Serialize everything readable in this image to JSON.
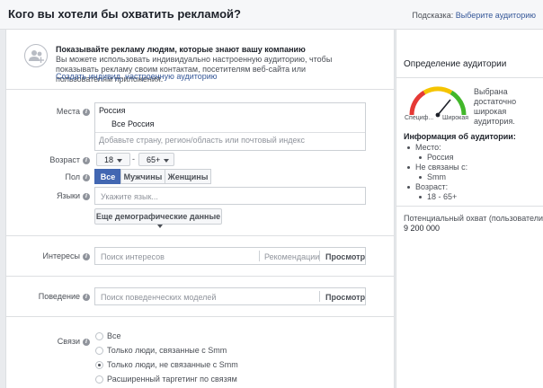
{
  "header": {
    "title": "Кого вы хотели бы охватить рекламой?",
    "hint_prefix": "Подсказка: ",
    "hint_link": "Выберите аудиторию"
  },
  "custom_audience": {
    "title": "Показывайте рекламу людям, которые знают вашу компанию",
    "description": "Вы можете использовать индивидуально настроенную аудиторию, чтобы показывать рекламу своим контактам, посетителям веб-сайта или пользователям приложения.",
    "link": "Создать индивид. настроенную аудиторию"
  },
  "locations": {
    "label": "Места",
    "country": "Россия",
    "region": "Все Россия",
    "placeholder": "Добавьте страну, регион/область или почтовый индекс"
  },
  "age": {
    "label": "Возраст",
    "min": "18",
    "dash": "-",
    "max": "65+"
  },
  "gender": {
    "label": "Пол",
    "options": [
      "Все",
      "Мужчины",
      "Женщины"
    ],
    "selected": 0
  },
  "languages": {
    "label": "Языки",
    "placeholder": "Укажите язык..."
  },
  "more_demographics": "Еще демографические данные",
  "interests": {
    "label": "Интересы",
    "placeholder": "Поиск интересов",
    "suggestions": "Рекомендации",
    "browse": "Просмотр"
  },
  "behaviors": {
    "label": "Поведение",
    "placeholder": "Поиск поведенческих моделей",
    "browse": "Просмотр"
  },
  "connections": {
    "label": "Связи",
    "options": [
      "Все",
      "Только люди, связанные с Smm",
      "Только люди, не связанные с Smm",
      "Расширенный таргетинг по связям"
    ],
    "selected": 2
  },
  "sidebar": {
    "title": "Определение аудитории",
    "gauge": {
      "left_label": "Специф...",
      "right_label": "Широкая",
      "description": "Выбрана достаточно широкая аудитория.",
      "level": 0.72
    },
    "audience_title": "Информация об аудитории:",
    "audience": {
      "place_label": "Место:",
      "place_value": "Россия",
      "not_connected_label": "Не связаны с:",
      "not_connected_value": "Smm",
      "age_label": "Возраст:",
      "age_value": "18 - 65+"
    },
    "reach_label": "Потенциальный охват (пользователи):",
    "reach_value": "9 200 000"
  },
  "colors": {
    "accent": "#4267b2",
    "link": "#365899",
    "gauge_red": "#e53935",
    "gauge_yellow": "#f5c400",
    "gauge_green": "#42b72a"
  }
}
